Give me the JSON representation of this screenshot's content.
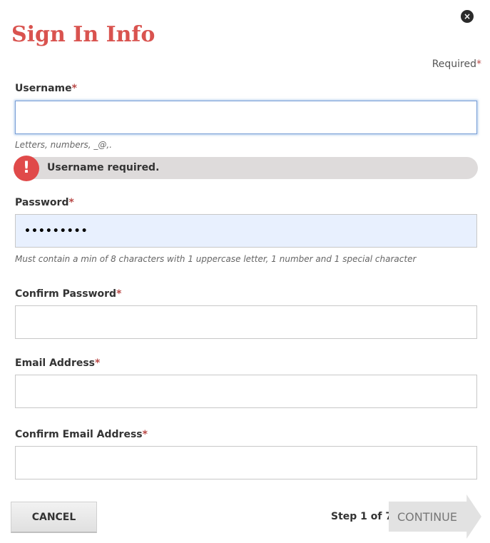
{
  "header": {
    "title": "Sign In Info",
    "close_icon": "×",
    "required_note": "Required",
    "required_star": "*"
  },
  "form": {
    "username": {
      "label": "Username",
      "value": "",
      "hint": "Letters, numbers, _@,.",
      "error": "Username required.",
      "error_icon": "!"
    },
    "password": {
      "label": "Password",
      "value": "•••••••••",
      "hint": "Must contain a min of 8 characters with 1 uppercase letter, 1 number and 1 special character"
    },
    "confirm_password": {
      "label": "Confirm Password",
      "value": ""
    },
    "email": {
      "label": "Email Address",
      "value": ""
    },
    "confirm_email": {
      "label": "Confirm Email Address",
      "value": ""
    }
  },
  "footer": {
    "cancel_label": "CANCEL",
    "step_text": "Step 1 of 7",
    "continue_label": "CONTINUE"
  },
  "colors": {
    "title": "#d9534f",
    "required_star": "#b94a48",
    "error_icon": "#e04a4a",
    "error_bar": "#dedbdb",
    "filled_input": "#e8f0fe",
    "focus_border": "#7a9fd6"
  },
  "icons": {
    "close": "close-icon",
    "error": "exclamation-icon"
  }
}
